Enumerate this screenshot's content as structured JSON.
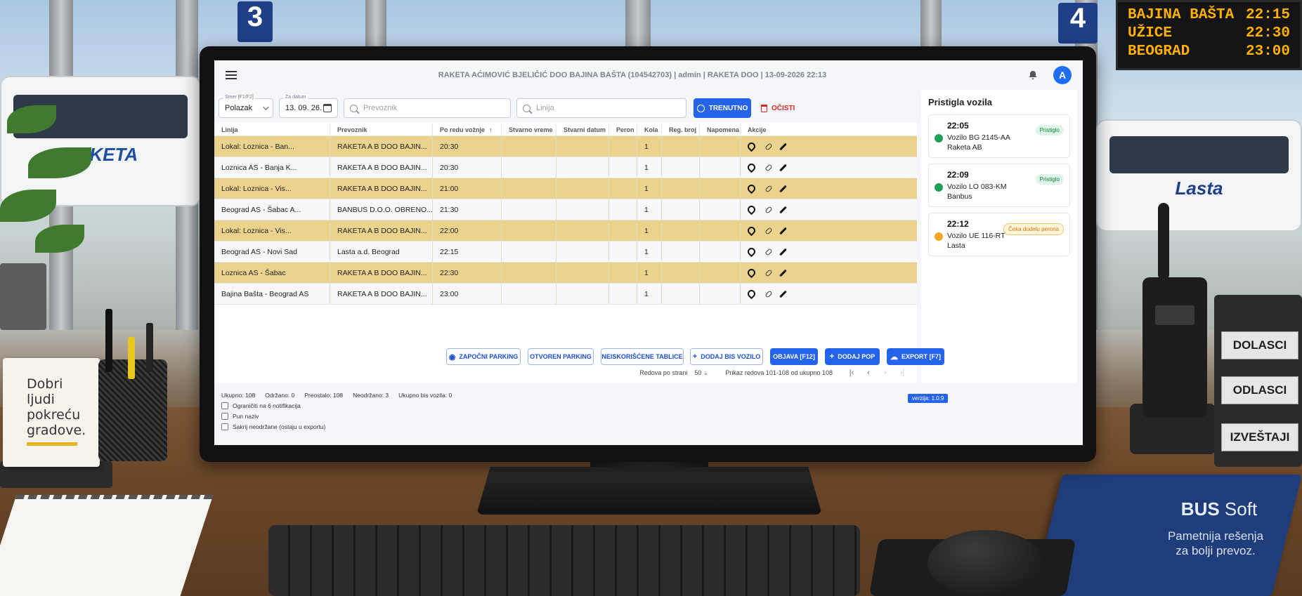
{
  "scene": {
    "platform_left": "3",
    "platform_right": "4",
    "led_rows": [
      {
        "city": "BAJINA BAŠTA",
        "time": "22:15"
      },
      {
        "city": "UŽICE",
        "time": "22:30"
      },
      {
        "city": "BEOGRAD",
        "time": "23:00"
      }
    ],
    "bus_left_text": "RAKETA",
    "bus_right_text": "Lasta",
    "card_text_lines": [
      "Dobri",
      "ljudi",
      "pokreću",
      "gradove."
    ],
    "organizer_tabs": [
      "DOLASCI",
      "ODLASCI",
      "IZVEŠTAJI"
    ],
    "folder_brand_bold": "BUS",
    "folder_brand_light": " Soft",
    "folder_tagline_1": "Pametnija rešenja",
    "folder_tagline_2": "za bolji prevoz."
  },
  "header": {
    "title": "RAKETA AĆIMOVIĆ BJELIČIĆ DOO BAJINA BAŠTA (104542703) | admin | RAKETA DOO | 13-09-2026 22:13",
    "avatar_letter": "A"
  },
  "filters": {
    "direction_label": "Smer [F1/F2]",
    "direction_value": "Polazak",
    "date_label": "Za datum",
    "date_value": "13. 09. 26.",
    "carrier_placeholder": "Prevoznik",
    "line_placeholder": "Linija",
    "now_button": "TRENUTNO",
    "clear_button": "OČISTI"
  },
  "table": {
    "columns": [
      "Linija",
      "Prevoznik",
      "Po redu vožnje",
      "Stvarno vreme",
      "Stvarni datum",
      "Peron",
      "Kola",
      "Reg. broj",
      "Napomena",
      "Akcije"
    ],
    "rows": [
      {
        "line": "Lokal: Loznica - Ban...",
        "carrier": "RAKETA A B DOO BAJIN...",
        "scheduled": "20:30",
        "kola": "1",
        "highlight": true
      },
      {
        "line": "Loznica AS - Banja K...",
        "carrier": "RAKETA A B DOO BAJIN...",
        "scheduled": "20:30",
        "kola": "1",
        "highlight": false
      },
      {
        "line": "Lokal: Loznica - Vis...",
        "carrier": "RAKETA A B DOO BAJIN...",
        "scheduled": "21:00",
        "kola": "1",
        "highlight": true
      },
      {
        "line": "Beograd AS - Šabac A...",
        "carrier": "BANBUS D.O.O. OBRENO...",
        "scheduled": "21:30",
        "kola": "1",
        "highlight": false
      },
      {
        "line": "Lokal: Loznica - Vis...",
        "carrier": "RAKETA A B DOO BAJIN...",
        "scheduled": "22:00",
        "kola": "1",
        "highlight": true
      },
      {
        "line": "Beograd AS - Novi Sad",
        "carrier": "Lasta a.d. Beograd",
        "scheduled": "22:15",
        "kola": "1",
        "highlight": false
      },
      {
        "line": "Loznica AS - Šabac",
        "carrier": "RAKETA A B DOO BAJIN...",
        "scheduled": "22:30",
        "kola": "1",
        "highlight": true
      },
      {
        "line": "Bajina Bašta - Beograd AS",
        "carrier": "RAKETA A B DOO BAJIN...",
        "scheduled": "23:00",
        "kola": "1",
        "highlight": false
      }
    ]
  },
  "pager": {
    "rows_per_page_label": "Redova po strani",
    "rows_per_page_value": "50",
    "range_text": "Prikaz redova 101-108 od ukupno 108"
  },
  "stats": {
    "total": "Ukupno: 108",
    "held": "Održano: 0",
    "remaining": "Preostalo: 108",
    "not_held": "Neodržano: 3",
    "bis_total": "Ukupno bis vozila: 0"
  },
  "checkboxes": [
    "Ograničiti na 6 notifikacija",
    "Pun naziv",
    "Sakrij neodržane (ostaju u exportu)"
  ],
  "actions": {
    "start_parking": "ZAPOČNI PARKING",
    "open_parking": "OTVOREN PARKING",
    "unused_plates": "NEISKORIŠĆENE TABLICE",
    "add_bis": "DODAJ BIS VOZILO",
    "publish": "OBJAVA [F12]",
    "add_pop": "DODAJ POP",
    "export": "EXPORT [F7]"
  },
  "version": "verzija: 1.0.9",
  "arrivals": {
    "title": "Pristigla vozila",
    "items": [
      {
        "time": "22:05",
        "vehicle": "Vozilo BG 2145-AA",
        "carrier": "Raketa AB",
        "status": "Pristiglo",
        "color": "#22a05a"
      },
      {
        "time": "22:09",
        "vehicle": "Vozilo LO 083-KM",
        "carrier": "Banbus",
        "status": "Pristiglo",
        "color": "#22a05a"
      },
      {
        "time": "22:12",
        "vehicle": "Vozilo UE 116-RT",
        "carrier": "Lasta",
        "status": "Čeka dodelu perona",
        "color": "#f5a524"
      }
    ]
  },
  "colors": {
    "accent": "#2563eb",
    "row_highlight": "#ecd38d",
    "danger": "#dc2626"
  }
}
